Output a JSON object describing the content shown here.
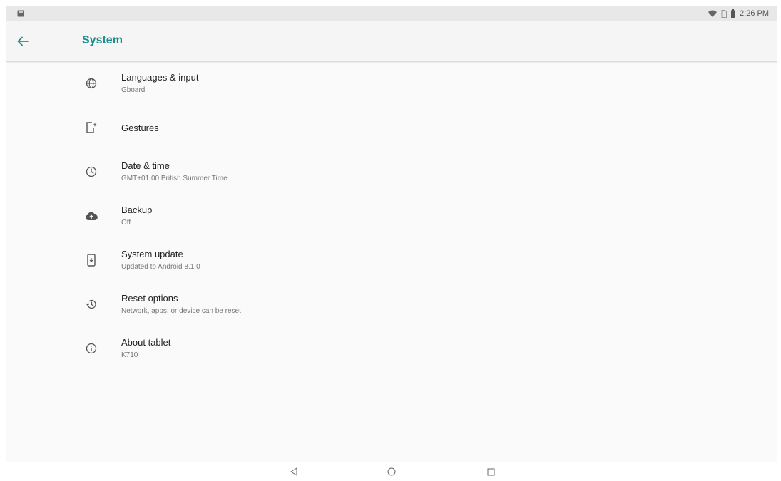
{
  "status_bar": {
    "time": "2:26 PM",
    "left_icon": "screenshot-icon",
    "right_icons": [
      "wifi-icon",
      "sim-icon",
      "battery-icon"
    ]
  },
  "app_bar": {
    "title": "System",
    "back_icon": "arrow-left-icon",
    "accent_color": "#1a8f8a"
  },
  "items": [
    {
      "icon": "globe-icon",
      "title": "Languages & input",
      "summary": "Gboard"
    },
    {
      "icon": "gesture-phone-icon",
      "title": "Gestures",
      "summary": ""
    },
    {
      "icon": "clock-icon",
      "title": "Date & time",
      "summary": "GMT+01:00 British Summer Time"
    },
    {
      "icon": "cloud-upload-icon",
      "title": "Backup",
      "summary": "Off"
    },
    {
      "icon": "system-update-icon",
      "title": "System update",
      "summary": "Updated to Android 8.1.0"
    },
    {
      "icon": "history-icon",
      "title": "Reset options",
      "summary": "Network, apps, or device can be reset"
    },
    {
      "icon": "info-icon",
      "title": "About tablet",
      "summary": "K710"
    }
  ],
  "nav_bar": {
    "icons": [
      "back-triangle-icon",
      "home-circle-icon",
      "recents-square-icon"
    ]
  }
}
